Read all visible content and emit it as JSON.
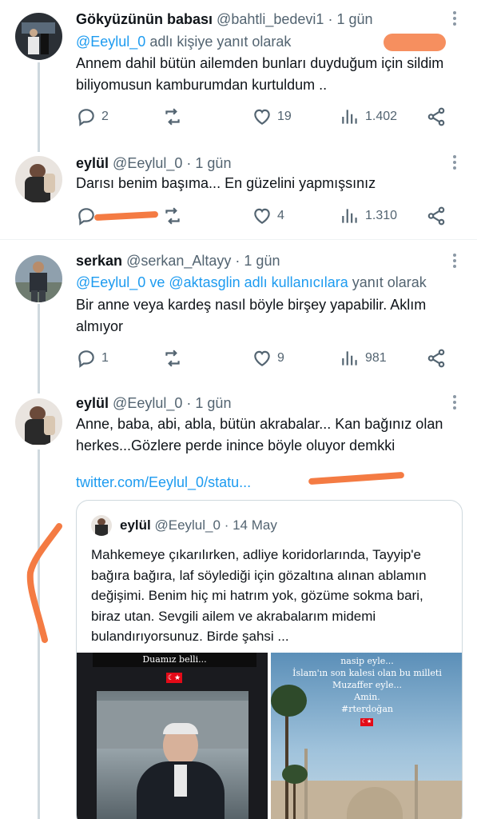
{
  "tweets": [
    {
      "name": "Gökyüzünün babası",
      "handle": "@bahtli_bedevi1",
      "time": "1 gün",
      "reply_mention": "@Eeylul_0",
      "reply_suffix": "adlı kişiye yanıt olarak",
      "text": "Annem dahil bütün ailemden bunları duyduğum için sildim biliyomusun kamburumdan kurtuldum ..",
      "replies": "2",
      "retweets": "",
      "likes": "19",
      "views": "1.402"
    },
    {
      "name": "eylül",
      "handle": "@Eeylul_0",
      "time": "1 gün",
      "text": "Darısı benim başıma... En güzelini yapmışsınız",
      "replies": "",
      "retweets": "",
      "likes": "4",
      "views": "1.310"
    },
    {
      "name": "serkan",
      "handle": "@serkan_Altayy",
      "time": "1 gün",
      "reply_mention": "@Eeylul_0 ve @aktasglin adlı kullanıcılara",
      "reply_suffix": "yanıt olarak",
      "text": "Bir anne veya kardeş nasıl böyle birşey yapabilir. Aklım almıyor",
      "replies": "1",
      "retweets": "",
      "likes": "9",
      "views": "981"
    },
    {
      "name": "eylül",
      "handle": "@Eeylul_0",
      "time": "1 gün",
      "text": "Anne, baba, abi, abla, bütün akrabalar... Kan bağınız olan herkes...Gözlere perde inince böyle oluyor demkki",
      "link": "twitter.com/Eeylul_0/statu..."
    }
  ],
  "quote": {
    "name": "eylül",
    "handle": "@Eeylul_0",
    "time": "14 May",
    "text": "Mahkemeye çıkarılırken, adliye koridorlarında, Tayyip'e bağıra bağıra, laf söylediği için gözaltına alınan ablamın değişimi. Benim hiç mi hatrım yok, gözüme sokma bari, biraz utan. Sevgili ailem ve akrabalarım midemi bulandırıyorsunuz. Birde şahsi ...",
    "image1_caption": "Duamız belli...",
    "image2_caption": [
      "nasip eyle...",
      "İslam'ın son kalesi olan bu milleti",
      "Muzaffer eyle...",
      "Amin.",
      "#rterdoğan"
    ]
  },
  "separator": "·",
  "colors": {
    "accent": "#1d9bf0",
    "secondary": "#536471",
    "marker": "#f47b43"
  },
  "icons": [
    "reply-icon",
    "retweet-icon",
    "like-icon",
    "views-icon",
    "share-icon",
    "more-icon"
  ]
}
